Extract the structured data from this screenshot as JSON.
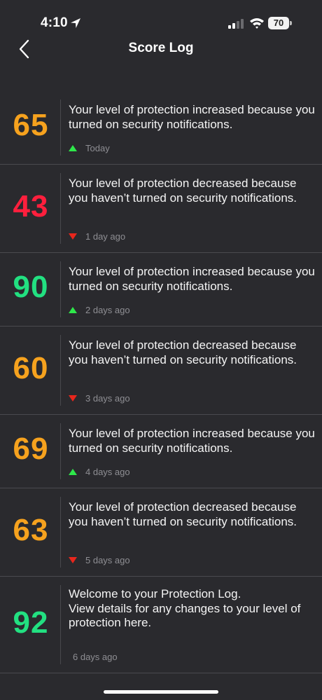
{
  "status": {
    "time": "4:10",
    "battery": "70"
  },
  "nav": {
    "title": "Score Log"
  },
  "colors": {
    "orange": "#f6a21e",
    "red": "#ff1f3d",
    "green": "#22e081",
    "up": "#2ee84a",
    "down": "#e8261c"
  },
  "entries": [
    {
      "score": "65",
      "color": "orange",
      "trend": "up",
      "message": "Your level of protection increased because you turned on security notifications.",
      "time": "Today"
    },
    {
      "score": "43",
      "color": "red",
      "trend": "down",
      "message": "Your level of protection decreased because you haven’t turned on security notifications.",
      "time": "1 day ago"
    },
    {
      "score": "90",
      "color": "green",
      "trend": "up",
      "message": "Your level of protection increased because you turned on security notifications.",
      "time": "2 days ago"
    },
    {
      "score": "60",
      "color": "orange",
      "trend": "down",
      "message": "Your level of protection decreased because you haven’t turned on security notifications.",
      "time": "3 days ago"
    },
    {
      "score": "69",
      "color": "orange",
      "trend": "up",
      "message": "Your level of protection increased because you turned on security notifications.",
      "time": "4 days ago"
    },
    {
      "score": "63",
      "color": "orange",
      "trend": "down",
      "message": "Your level of protection decreased because you haven’t turned on security notifications.",
      "time": "5 days ago"
    },
    {
      "score": "92",
      "color": "green",
      "trend": "none",
      "message": "Welcome to your Protection Log.\nView details for any changes to your level of protection here.",
      "time": "6 days ago"
    }
  ]
}
